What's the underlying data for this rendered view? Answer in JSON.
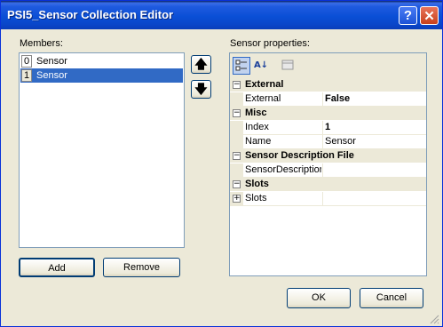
{
  "window": {
    "title": "PSI5_Sensor Collection Editor",
    "help_glyph": "?",
    "close_glyph": "✕"
  },
  "members": {
    "label": "Members:",
    "items": [
      {
        "index": "0",
        "name": "Sensor",
        "selected": false
      },
      {
        "index": "1",
        "name": "Sensor",
        "selected": true
      }
    ],
    "move_up_glyph": "🡅",
    "move_down_glyph": "🡇",
    "add_label": "Add",
    "remove_label": "Remove"
  },
  "properties": {
    "label": "Sensor properties:",
    "toolbar": {
      "categorized_icon": "categorized-icon",
      "alphabetical_icon": "alphabetical-icon",
      "property_pages_icon": "property-pages-icon",
      "alphabetical_glyph": "A↓"
    },
    "categories": [
      {
        "name": "External",
        "toggle": "−",
        "props": [
          {
            "name": "External",
            "value": "False",
            "bold": true
          }
        ]
      },
      {
        "name": "Misc",
        "toggle": "−",
        "props": [
          {
            "name": "Index",
            "value": "1",
            "bold": true
          },
          {
            "name": "Name",
            "value": "Sensor",
            "bold": false
          }
        ]
      },
      {
        "name": "Sensor Description File",
        "toggle": "−",
        "props": [
          {
            "name": "SensorDescription",
            "value": "",
            "bold": false
          }
        ]
      },
      {
        "name": "Slots",
        "toggle": "−",
        "props": [
          {
            "name": "Slots",
            "value": "",
            "bold": false,
            "expander": "+"
          }
        ]
      }
    ]
  },
  "footer": {
    "ok_label": "OK",
    "cancel_label": "Cancel"
  },
  "colors": {
    "selection": "#316ac5",
    "titlebar": "#0a4fd6",
    "dialog_bg": "#ece9d8"
  }
}
